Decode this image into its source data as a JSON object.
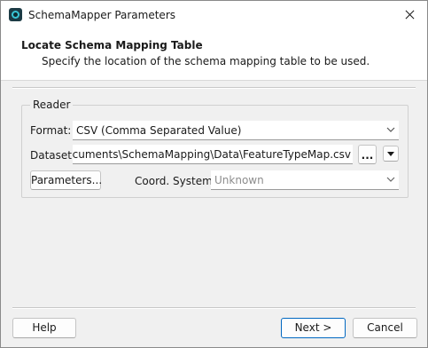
{
  "window": {
    "title": "SchemaMapper Parameters"
  },
  "header": {
    "title": "Locate Schema Mapping Table",
    "subtitle": "Specify the location of the schema mapping table to be used."
  },
  "reader": {
    "group_label": "Reader",
    "format_label": "Format:",
    "format_value": "CSV (Comma Separated Value)",
    "dataset_label": "Dataset:",
    "dataset_value": "C:\\Users\\fe\\Documents\\SchemaMapping\\Data\\FeatureTypeMap.csv",
    "dataset_visible": "fe\\Documents\\SchemaMapping\\Data\\FeatureTypeMap.csv",
    "browse_label": "...",
    "parameters_label": "Parameters...",
    "coord_label": "Coord. System:",
    "coord_value": "Unknown"
  },
  "footer": {
    "help_label": "Help",
    "next_label": "Next >",
    "cancel_label": "Cancel"
  }
}
